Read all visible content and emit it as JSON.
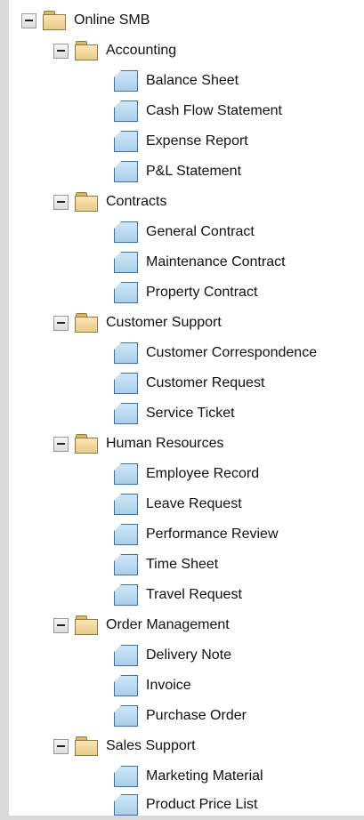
{
  "tree": {
    "root": {
      "label": "Online SMB",
      "icon": "folder-icon",
      "expanded": true
    },
    "folders": [
      {
        "label": "Accounting",
        "expanded": true,
        "items": [
          "Balance Sheet",
          "Cash Flow Statement",
          "Expense Report",
          "P&L Statement"
        ]
      },
      {
        "label": "Contracts",
        "expanded": true,
        "items": [
          "General Contract",
          "Maintenance Contract",
          "Property Contract"
        ]
      },
      {
        "label": "Customer Support",
        "expanded": true,
        "items": [
          "Customer Correspondence",
          "Customer Request",
          "Service Ticket"
        ]
      },
      {
        "label": "Human Resources",
        "expanded": true,
        "items": [
          "Employee Record",
          "Leave Request",
          "Performance Review",
          "Time Sheet",
          "Travel Request"
        ]
      },
      {
        "label": "Order Management",
        "expanded": true,
        "items": [
          "Delivery Note",
          "Invoice",
          "Purchase Order"
        ]
      },
      {
        "label": "Sales Support",
        "expanded": true,
        "items": [
          "Marketing Material",
          "Product Price List"
        ]
      }
    ]
  },
  "colors": {
    "background": "#d9d9d9",
    "panel": "#ffffff",
    "folder": "#f0d597",
    "document": "#b9dbf2"
  }
}
